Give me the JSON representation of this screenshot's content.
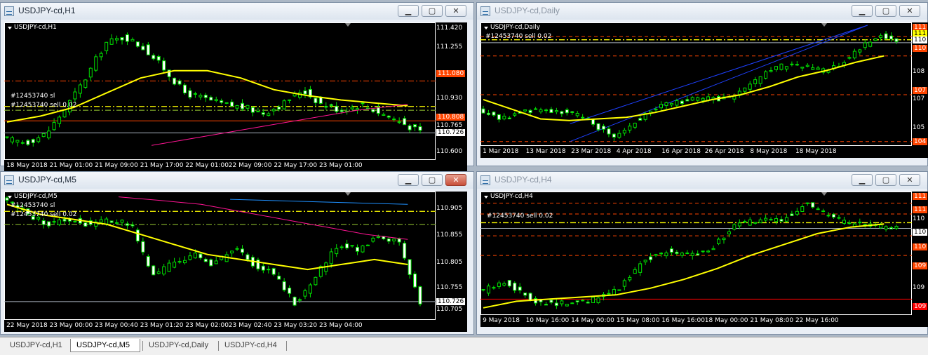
{
  "colors": {
    "background": "#000000",
    "bull": "#00e000",
    "bear": "#ffffff",
    "ma_yellow": "#ffff00",
    "ma_pink": "#ff1493",
    "ma_blue": "#1e90ff",
    "level_orange": "#ff4500",
    "level_red": "#ff0000",
    "level_green": "#9acd32",
    "current": "#aab4c0"
  },
  "icons": {
    "window": "chart-window-icon",
    "minimize": "minimize-icon",
    "maximize": "maximize-icon",
    "close": "close-icon"
  },
  "windows": [
    {
      "title": "USDJPY-cd,H1",
      "label": "USDJPY-cd,H1",
      "order_labels": [
        "#12453740 sl",
        "#12453740 sell 0.02"
      ],
      "prices": [
        "111.420",
        "111.255",
        "111.080",
        "110.930",
        "110.808",
        "110.765",
        "110.726",
        "110.600"
      ],
      "dates": [
        "18 May 2018",
        "21 May 01:00",
        "21 May 09:00",
        "21 May 17:00",
        "22 May 01:00",
        "22 May 09:00",
        "22 May 17:00",
        "23 May 01:00"
      ]
    },
    {
      "title": "USDJPY-cd,Daily",
      "label": "USDJPY-cd,Daily",
      "order_labels": [
        "#12453740 sell 0.02"
      ],
      "prices": [
        "111",
        "111",
        "110",
        "110",
        "108",
        "107",
        "107",
        "105",
        "104"
      ],
      "dates": [
        "1 Mar 2018",
        "13 Mar 2018",
        "23 Mar 2018",
        "4 Apr 2018",
        "16 Apr 2018",
        "26 Apr 2018",
        "8 May 2018",
        "18 May 2018"
      ]
    },
    {
      "title": "USDJPY-cd,M5",
      "label": "USDJPY-cd,M5",
      "order_labels": [
        "#12453740 sl",
        "#12453740 sell 0.02"
      ],
      "prices": [
        "110.905",
        "110.855",
        "110.805",
        "110.755",
        "110.726",
        "110.705"
      ],
      "dates": [
        "22 May 2018",
        "23 May 00:00",
        "23 May 00:40",
        "23 May 01:20",
        "23 May 02:00",
        "23 May 02:40",
        "23 May 03:20",
        "23 May 04:00"
      ]
    },
    {
      "title": "USDJPY-cd,H4",
      "label": "USDJPY-cd,H4",
      "order_labels": [
        "#12453740 sell 0.02"
      ],
      "prices": [
        "111",
        "111",
        "110",
        "110",
        "110",
        "109",
        "109",
        "109"
      ],
      "dates": [
        "9 May 2018",
        "10 May 16:00",
        "14 May 00:00",
        "15 May 08:00",
        "16 May 16:00",
        "18 May 00:00",
        "21 May 08:00",
        "22 May 16:00"
      ]
    }
  ],
  "tabs": [
    "USDJPY-cd,H1",
    "USDJPY-cd,M5",
    "USDJPY-cd,Daily",
    "USDJPY-cd,H4"
  ],
  "active_tab": 1,
  "chart_data": [
    {
      "type": "candlestick",
      "title": "USDJPY-cd,H1",
      "ylim": [
        110.56,
        111.46
      ],
      "x": [
        "18 May 2018",
        "21 May 01:00",
        "21 May 09:00",
        "21 May 17:00",
        "22 May 01:00",
        "22 May 09:00",
        "22 May 17:00",
        "23 May 01:00"
      ],
      "close_path": [
        110.68,
        110.66,
        110.72,
        110.9,
        111.1,
        111.34,
        111.38,
        111.3,
        111.16,
        111.0,
        110.96,
        110.92,
        110.9,
        110.86,
        110.92,
        111.02,
        110.92,
        110.88,
        110.92,
        110.86,
        110.8,
        110.73
      ],
      "levels": [
        {
          "value": 111.08,
          "color": "#ff4500",
          "style": "dash-dot"
        },
        {
          "value": 110.906,
          "color": "#ffff00",
          "style": "dash-dot"
        },
        {
          "value": 110.88,
          "color": "#9acd32",
          "style": "dash-dot"
        },
        {
          "value": 110.808,
          "color": "#ff4500",
          "style": "solid"
        },
        {
          "value": 110.726,
          "color": "#aab4c0",
          "style": "solid"
        }
      ],
      "ma_yellow": [
        110.8,
        110.84,
        110.9,
        111.0,
        111.1,
        111.15,
        111.15,
        111.1,
        111.02,
        110.98,
        110.95,
        110.93,
        110.91
      ],
      "ma_pink": [
        110.64,
        110.7,
        110.76,
        110.82,
        110.88,
        110.92
      ]
    },
    {
      "type": "candlestick",
      "title": "USDJPY-cd,Daily",
      "ylim": [
        104.5,
        111.8
      ],
      "x": [
        "1 Mar 2018",
        "13 Mar 2018",
        "23 Mar 2018",
        "4 Apr 2018",
        "16 Apr 2018",
        "26 Apr 2018",
        "8 May 2018",
        "18 May 2018"
      ],
      "close_path": [
        106.5,
        106.0,
        106.4,
        106.6,
        106.5,
        106.2,
        105.6,
        104.9,
        105.8,
        106.6,
        107.0,
        107.2,
        107.2,
        107.3,
        107.8,
        108.9,
        109.3,
        109.3,
        109.0,
        109.4,
        110.3,
        111.2,
        110.9
      ],
      "levels": [
        {
          "value": 111.1,
          "color": "#ff4500",
          "style": "dash"
        },
        {
          "value": 110.9,
          "color": "#ffff00",
          "style": "dash-dot"
        },
        {
          "value": 110.72,
          "color": "#aab4c0",
          "style": "solid"
        },
        {
          "value": 109.9,
          "color": "#ff4500",
          "style": "dash"
        },
        {
          "value": 107.5,
          "color": "#ff4500",
          "style": "dash"
        },
        {
          "value": 104.6,
          "color": "#ff4500",
          "style": "dash"
        }
      ],
      "ma_yellow": [
        107.2,
        106.6,
        106.0,
        105.9,
        106.0,
        106.1,
        106.4,
        106.8,
        107.2,
        107.5,
        108.0,
        108.6,
        109.0,
        109.5,
        109.9
      ],
      "channel": [
        [
          104.6,
          111.8
        ],
        [
          105.7,
          111.8
        ]
      ]
    },
    {
      "type": "candlestick",
      "title": "USDJPY-cd,M5",
      "ylim": [
        110.695,
        110.94
      ],
      "x": [
        "22 May 2018",
        "23 May 00:00",
        "23 May 00:40",
        "23 May 01:20",
        "23 May 02:00",
        "23 May 02:40",
        "23 May 03:20",
        "23 May 04:00"
      ],
      "close_path": [
        110.93,
        110.9,
        110.88,
        110.89,
        110.88,
        110.89,
        110.88,
        110.78,
        110.8,
        110.82,
        110.8,
        110.83,
        110.8,
        110.78,
        110.72,
        110.78,
        110.84,
        110.83,
        110.86,
        110.84,
        110.72
      ],
      "levels": [
        {
          "value": 110.906,
          "color": "#ffff00",
          "style": "dash-dot"
        },
        {
          "value": 110.88,
          "color": "#9acd32",
          "style": "dash-dot"
        },
        {
          "value": 110.726,
          "color": "#aab4c0",
          "style": "solid"
        }
      ],
      "ma_yellow": [
        110.92,
        110.9,
        110.89,
        110.88,
        110.86,
        110.84,
        110.82,
        110.81,
        110.8,
        110.79,
        110.8,
        110.81,
        110.8
      ],
      "ma_pink": [
        110.935,
        110.928,
        110.92,
        110.905,
        110.89,
        110.875,
        110.86,
        110.85
      ],
      "ma_blue": [
        110.93,
        110.925,
        110.92
      ]
    },
    {
      "type": "candlestick",
      "title": "USDJPY-cd,H4",
      "ylim": [
        108.9,
        111.6
      ],
      "x": [
        "9 May 2018",
        "10 May 16:00",
        "14 May 00:00",
        "15 May 08:00",
        "16 May 16:00",
        "18 May 00:00",
        "21 May 08:00",
        "22 May 16:00"
      ],
      "close_path": [
        109.4,
        109.6,
        109.2,
        109.1,
        109.1,
        109.2,
        109.5,
        110.1,
        110.3,
        110.2,
        110.4,
        110.9,
        111.0,
        111.0,
        111.4,
        111.1,
        110.9,
        110.9,
        110.8
      ],
      "levels": [
        {
          "value": 111.4,
          "color": "#ff4500",
          "style": "dash"
        },
        {
          "value": 111.15,
          "color": "#ff4500",
          "style": "dash"
        },
        {
          "value": 110.95,
          "color": "#ffff00",
          "style": "dash-dot"
        },
        {
          "value": 110.82,
          "color": "#aab4c0",
          "style": "solid"
        },
        {
          "value": 110.65,
          "color": "#ff4500",
          "style": "dash"
        },
        {
          "value": 110.2,
          "color": "#ff4500",
          "style": "dash"
        },
        {
          "value": 109.2,
          "color": "#ff0000",
          "style": "solid"
        }
      ],
      "ma_yellow": [
        109.0,
        109.15,
        109.2,
        109.25,
        109.3,
        109.45,
        109.65,
        109.9,
        110.2,
        110.45,
        110.7,
        110.85,
        110.92
      ]
    }
  ]
}
